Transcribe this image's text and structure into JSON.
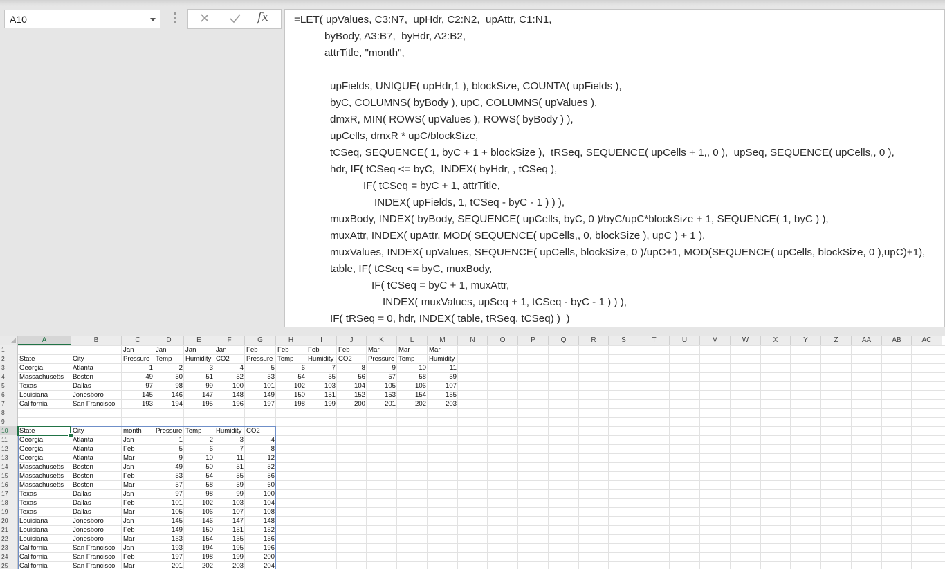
{
  "name_box": {
    "value": "A10"
  },
  "formula_bar": {
    "fx_label": "fx",
    "lines": [
      "=LET( upValues, C3:N7,  upHdr, C2:N2,  upAttr, C1:N1,",
      "byBody, A3:B7,  byHdr, A2:B2,",
      "attrTitle, \"month\",",
      "",
      "upFields, UNIQUE( upHdr,1 ), blockSize, COUNTA( upFields ),",
      "byC, COLUMNS( byBody ), upC, COLUMNS( upValues ),",
      "dmxR, MIN( ROWS( upValues ), ROWS( byBody ) ),",
      "upCells, dmxR * upC/blockSize,",
      "tCSeq, SEQUENCE( 1, byC + 1 + blockSize ),  tRSeq, SEQUENCE( upCells + 1,, 0 ),  upSeq, SEQUENCE( upCells,, 0 ),",
      "hdr, IF( tCSeq <= byC,  INDEX( byHdr, , tCSeq ),",
      "IF( tCSeq = byC + 1, attrTitle,",
      "INDEX( upFields, 1, tCSeq - byC - 1 ) ) ),",
      "muxBody, INDEX( byBody, SEQUENCE( upCells, byC, 0 )/byC/upC*blockSize + 1, SEQUENCE( 1, byC ) ),",
      "muxAttr, INDEX( upAttr, MOD( SEQUENCE( upCells,, 0, blockSize ), upC ) + 1 ),",
      "muxValues, INDEX( upValues, SEQUENCE( upCells, blockSize, 0 )/upC+1, MOD(SEQUENCE( upCells, blockSize, 0 ),upC)+1),",
      "table, IF( tCSeq <= byC, muxBody,",
      "IF( tCSeq = byC + 1, muxAttr,",
      "INDEX( muxValues, upSeq + 1, tCSeq - byC - 1 ) ) ),",
      "IF( tRSeq = 0, hdr, INDEX( table, tRSeq, tCSeq) )  )"
    ]
  },
  "columns": [
    "A",
    "B",
    "C",
    "D",
    "E",
    "F",
    "G",
    "H",
    "I",
    "J",
    "K",
    "L",
    "M",
    "N",
    "O",
    "P",
    "Q",
    "R",
    "S",
    "T",
    "U",
    "V",
    "W",
    "X",
    "Y",
    "Z",
    "AA",
    "AB",
    "AC"
  ],
  "selected_column": "A",
  "selected_row": 10,
  "rows": [
    [
      "",
      "",
      "Jan",
      "Jan",
      "Jan",
      "Jan",
      "Feb",
      "Feb",
      "Feb",
      "Feb",
      "Mar",
      "Mar",
      "Mar"
    ],
    [
      "State",
      "City",
      "Pressure",
      "Temp",
      "Humidity",
      "CO2",
      "Pressure",
      "Temp",
      "Humidity",
      "CO2",
      "Pressure",
      "Temp",
      "Humidity"
    ],
    [
      "Georgia",
      "Atlanta",
      "1",
      "2",
      "3",
      "4",
      "5",
      "6",
      "7",
      "8",
      "9",
      "10",
      "11"
    ],
    [
      "Massachusetts",
      "Boston",
      "49",
      "50",
      "51",
      "52",
      "53",
      "54",
      "55",
      "56",
      "57",
      "58",
      "59"
    ],
    [
      "Texas",
      "Dallas",
      "97",
      "98",
      "99",
      "100",
      "101",
      "102",
      "103",
      "104",
      "105",
      "106",
      "107"
    ],
    [
      "Louisiana",
      "Jonesboro",
      "145",
      "146",
      "147",
      "148",
      "149",
      "150",
      "151",
      "152",
      "153",
      "154",
      "155"
    ],
    [
      "California",
      "San Francisco",
      "193",
      "194",
      "195",
      "196",
      "197",
      "198",
      "199",
      "200",
      "201",
      "202",
      "203"
    ],
    [],
    [],
    [
      "State",
      "City",
      "month",
      "Pressure",
      "Temp",
      "Humidity",
      "CO2"
    ],
    [
      "Georgia",
      "Atlanta",
      "Jan",
      "1",
      "2",
      "3",
      "4"
    ],
    [
      "Georgia",
      "Atlanta",
      "Feb",
      "5",
      "6",
      "7",
      "8"
    ],
    [
      "Georgia",
      "Atlanta",
      "Mar",
      "9",
      "10",
      "11",
      "12"
    ],
    [
      "Massachusetts",
      "Boston",
      "Jan",
      "49",
      "50",
      "51",
      "52"
    ],
    [
      "Massachusetts",
      "Boston",
      "Feb",
      "53",
      "54",
      "55",
      "56"
    ],
    [
      "Massachusetts",
      "Boston",
      "Mar",
      "57",
      "58",
      "59",
      "60"
    ],
    [
      "Texas",
      "Dallas",
      "Jan",
      "97",
      "98",
      "99",
      "100"
    ],
    [
      "Texas",
      "Dallas",
      "Feb",
      "101",
      "102",
      "103",
      "104"
    ],
    [
      "Texas",
      "Dallas",
      "Mar",
      "105",
      "106",
      "107",
      "108"
    ],
    [
      "Louisiana",
      "Jonesboro",
      "Jan",
      "145",
      "146",
      "147",
      "148"
    ],
    [
      "Louisiana",
      "Jonesboro",
      "Feb",
      "149",
      "150",
      "151",
      "152"
    ],
    [
      "Louisiana",
      "Jonesboro",
      "Mar",
      "153",
      "154",
      "155",
      "156"
    ],
    [
      "California",
      "San Francisco",
      "Jan",
      "193",
      "194",
      "195",
      "196"
    ],
    [
      "California",
      "San Francisco",
      "Feb",
      "197",
      "198",
      "199",
      "200"
    ],
    [
      "California",
      "San Francisco",
      "Mar",
      "201",
      "202",
      "203",
      "204"
    ]
  ]
}
